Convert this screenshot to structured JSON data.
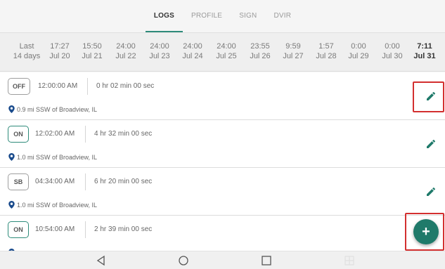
{
  "tabs": [
    {
      "label": "LOGS",
      "active": true
    },
    {
      "label": "PROFILE",
      "active": false
    },
    {
      "label": "SIGN",
      "active": false
    },
    {
      "label": "DVIR",
      "active": false
    }
  ],
  "days": [
    {
      "top": "Last",
      "bottom": "14 days"
    },
    {
      "top": "17:27",
      "bottom": "Jul 20"
    },
    {
      "top": "15:50",
      "bottom": "Jul 21"
    },
    {
      "top": "24:00",
      "bottom": "Jul 22"
    },
    {
      "top": "24:00",
      "bottom": "Jul 23"
    },
    {
      "top": "24:00",
      "bottom": "Jul 24"
    },
    {
      "top": "24:00",
      "bottom": "Jul 25"
    },
    {
      "top": "23:55",
      "bottom": "Jul 26"
    },
    {
      "top": "9:59",
      "bottom": "Jul 27"
    },
    {
      "top": "1:57",
      "bottom": "Jul 28"
    },
    {
      "top": "0:00",
      "bottom": "Jul 29"
    },
    {
      "top": "0:00",
      "bottom": "Jul 30"
    },
    {
      "top": "7:11",
      "bottom": "Jul 31"
    }
  ],
  "logs": [
    {
      "status": "OFF",
      "time": "12:00:00 AM",
      "duration": "0 hr 02 min 00 sec",
      "location": "0.9 mi SSW of Broadview, IL"
    },
    {
      "status": "ON",
      "time": "12:02:00 AM",
      "duration": "4 hr 32 min 00 sec",
      "location": "1.0 mi SSW of Broadview, IL"
    },
    {
      "status": "SB",
      "time": "04:34:00 AM",
      "duration": "6 hr 20 min 00 sec",
      "location": "1.0 mi SSW of Broadview, IL"
    },
    {
      "status": "ON",
      "time": "10:54:00 AM",
      "duration": "2 hr 39 min 00 sec",
      "location": ""
    }
  ],
  "fab": {
    "label": "+"
  },
  "colors": {
    "accent": "#2e8b7a",
    "fab": "#1f7a6a",
    "pin": "#1a4b8c",
    "highlight": "#d32f2f"
  }
}
